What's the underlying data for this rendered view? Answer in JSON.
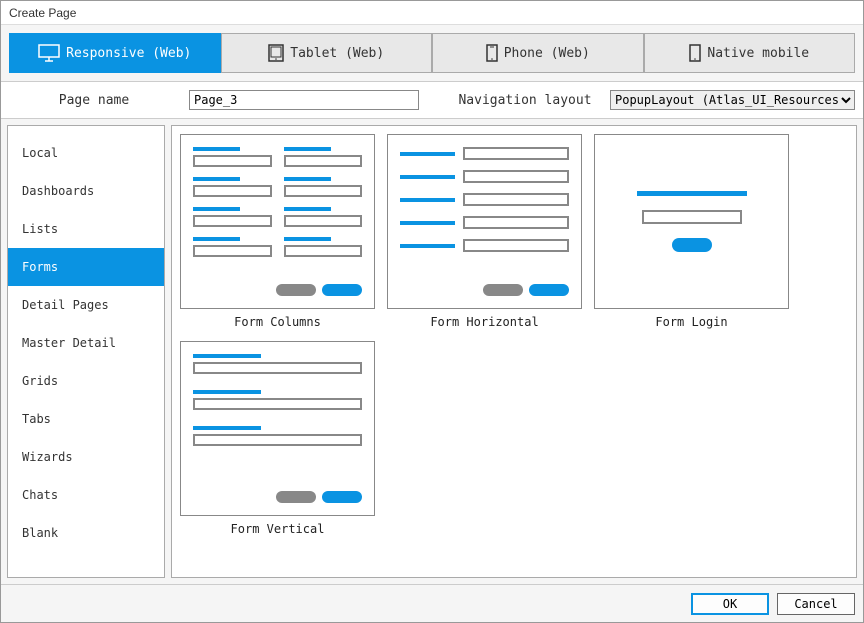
{
  "title": "Create Page",
  "device_tabs": [
    {
      "label": "Responsive (Web)",
      "icon": "monitor-icon",
      "active": true
    },
    {
      "label": "Tablet (Web)",
      "icon": "tablet-icon",
      "active": false
    },
    {
      "label": "Phone (Web)",
      "icon": "phone-icon",
      "active": false
    },
    {
      "label": "Native mobile",
      "icon": "native-mobile-icon",
      "active": false
    }
  ],
  "page_name_label": "Page name",
  "page_name_value": "Page_3",
  "navigation_layout_label": "Navigation layout",
  "navigation_layout_value": "PopupLayout (Atlas_UI_Resources)",
  "categories": [
    {
      "label": "Local",
      "active": false
    },
    {
      "label": "Dashboards",
      "active": false
    },
    {
      "label": "Lists",
      "active": false
    },
    {
      "label": "Forms",
      "active": true
    },
    {
      "label": "Detail Pages",
      "active": false
    },
    {
      "label": "Master Detail",
      "active": false
    },
    {
      "label": "Grids",
      "active": false
    },
    {
      "label": "Tabs",
      "active": false
    },
    {
      "label": "Wizards",
      "active": false
    },
    {
      "label": "Chats",
      "active": false
    },
    {
      "label": "Blank",
      "active": false
    }
  ],
  "templates": [
    {
      "label": "Form Columns",
      "kind": "columns"
    },
    {
      "label": "Form Horizontal",
      "kind": "horizontal"
    },
    {
      "label": "Form Login",
      "kind": "login"
    },
    {
      "label": "Form Vertical",
      "kind": "vertical"
    }
  ],
  "buttons": {
    "ok": "OK",
    "cancel": "Cancel"
  },
  "colors": {
    "accent": "#0a93e2"
  }
}
